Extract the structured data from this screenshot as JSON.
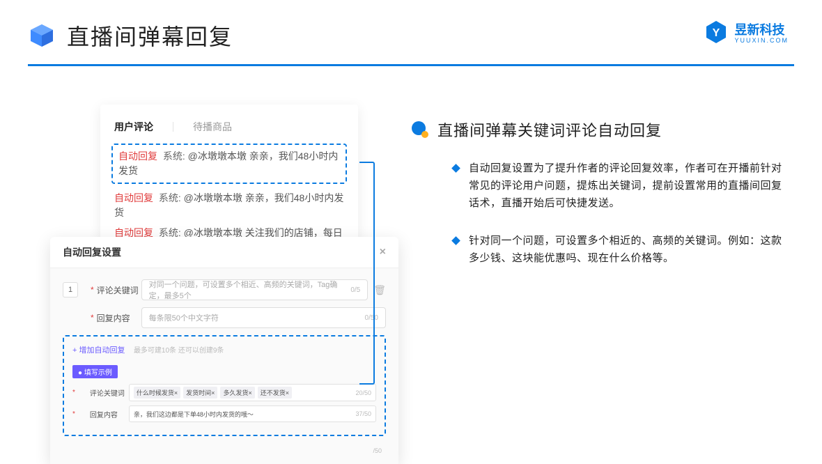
{
  "header": {
    "title": "直播间弹幕回复",
    "brand_name": "昱新科技",
    "brand_sub": "YUUXIN.COM"
  },
  "comments": {
    "tab_active": "用户评论",
    "tab_other": "待播商品",
    "auto_tag": "自动回复",
    "sys_tag": "系统:",
    "line1": "@冰墩墩本墩 亲亲，我们48小时内发货",
    "line2": "@冰墩墩本墩 亲亲，我们48小时内发货",
    "line3": "@冰墩墩本墩 关注我们的店铺，每日都有热门推荐呦～"
  },
  "settings": {
    "title": "自动回复设置",
    "num": "1",
    "label_keyword": "评论关键词",
    "placeholder_keyword": "对同一个问题，可设置多个相近、高频的关键词，Tag确定，最多5个",
    "counter_keyword": "0/5",
    "label_content": "回复内容",
    "placeholder_content": "每条限50个中文字符",
    "counter_content": "0/50",
    "add_link": "+ 增加自动回复",
    "add_hint": "最多可建10条 还可以创建9条",
    "example_tag": "● 填写示例",
    "ex_label_keyword": "评论关键词",
    "ex_tags": [
      "什么时候发货×",
      "发货时间×",
      "多久发货×",
      "还不发货×"
    ],
    "ex_counter_keyword": "20/50",
    "ex_label_content": "回复内容",
    "ex_content_text": "亲，我们这边都是下单48小时内发货的哦～",
    "ex_counter_content": "37/50",
    "outer_counter": "/50"
  },
  "right": {
    "subtitle": "直播间弹幕关键词评论自动回复",
    "bullet1": "自动回复设置为了提升作者的评论回复效率，作者可在开播前针对常见的评论用户问题，提炼出关键词，提前设置常用的直播间回复话术，直播开始后可快捷发送。",
    "bullet2": "针对同一个问题，可设置多个相近的、高频的关键词。例如：这款多少钱、这块能优惠吗、现在什么价格等。"
  }
}
